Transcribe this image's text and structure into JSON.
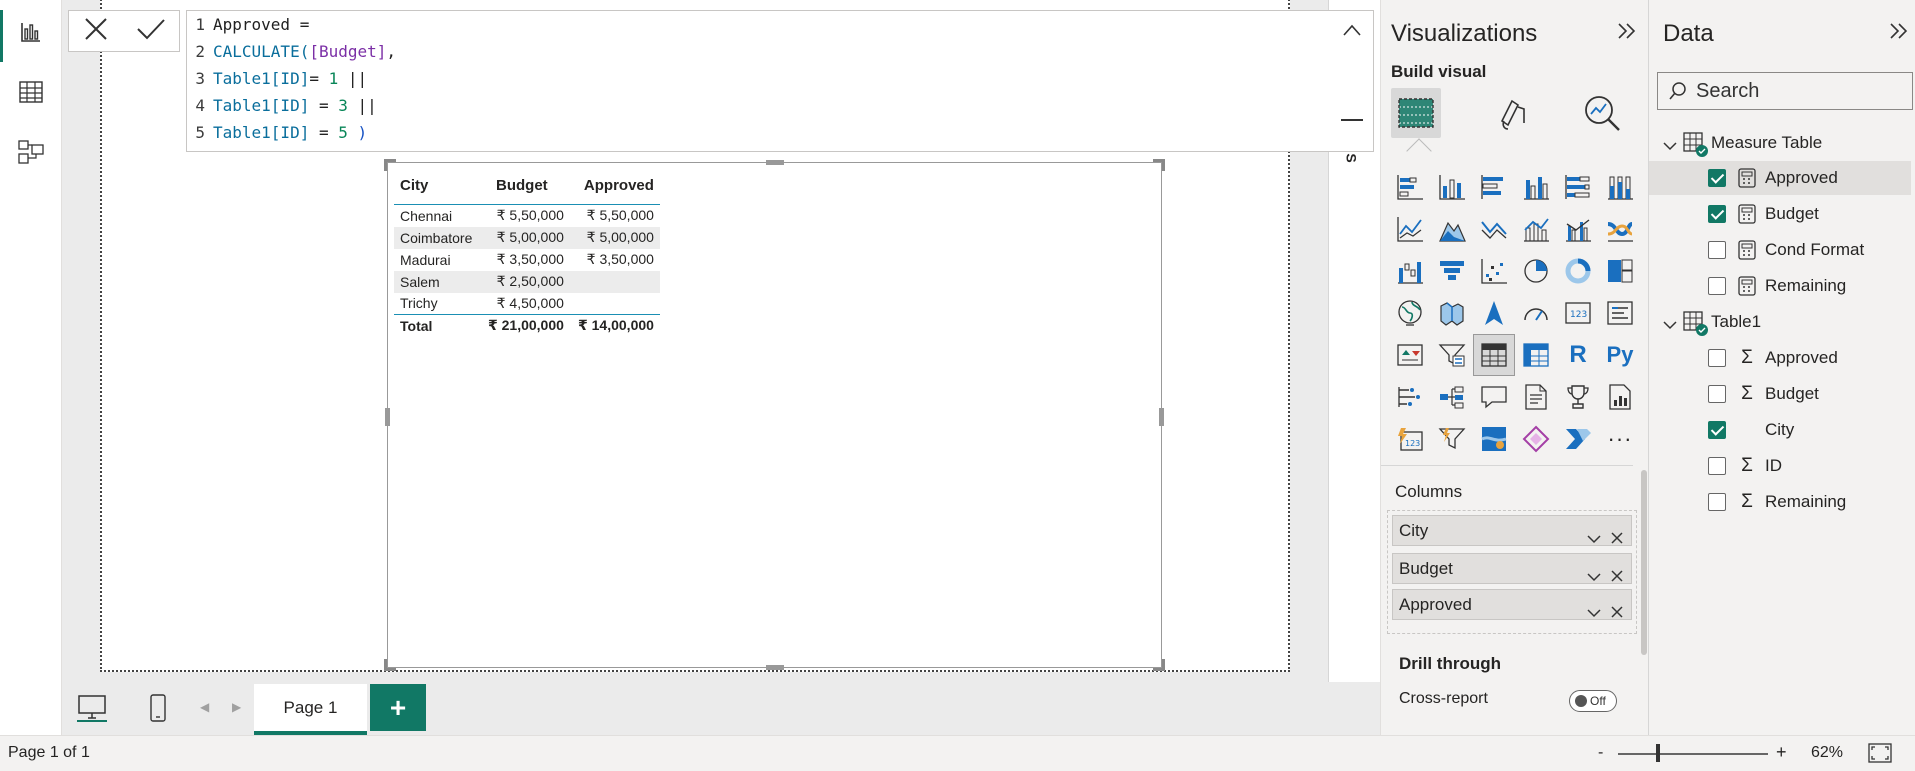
{
  "formula": {
    "line_numbers": [
      "1",
      "2",
      "3",
      "4",
      "5"
    ],
    "line1": "Approved =",
    "line2_fn": "CALCULATE(",
    "line2_ref": "[Budget]",
    "line2_end": ",",
    "line3_table": "Table1[ID]",
    "line3_op": "= ",
    "line3_num": "1",
    "line3_end": " ||",
    "line4_table": "Table1[ID]",
    "line4_op": " = ",
    "line4_num": "3",
    "line4_end": " ||",
    "line5_table": "Table1[ID]",
    "line5_op": " = ",
    "line5_num": "5",
    "line5_end": " )"
  },
  "table_visual": {
    "headers": [
      "City",
      "Budget",
      "Approved"
    ],
    "rows": [
      [
        "Chennai",
        "₹ 5,50,000",
        "₹ 5,50,000"
      ],
      [
        "Coimbatore",
        "₹ 5,00,000",
        "₹ 5,00,000"
      ],
      [
        "Madurai",
        "₹ 3,50,000",
        "₹ 3,50,000"
      ],
      [
        "Salem",
        "₹ 2,50,000",
        ""
      ],
      [
        "Trichy",
        "₹ 4,50,000",
        ""
      ]
    ],
    "total": [
      "Total",
      "₹ 21,00,000",
      "₹ 14,00,000"
    ]
  },
  "canvas": {
    "side_letter": "S"
  },
  "page_tabs": {
    "page1_label": "Page 1",
    "add_label": "+"
  },
  "status": {
    "page_info": "Page 1 of 1",
    "zoom_minus": "-",
    "zoom_plus": "+",
    "zoom_value": "62%"
  },
  "visualizations": {
    "title": "Visualizations",
    "build_label": "Build visual",
    "more_glyph": "···",
    "r_glyph": "R",
    "py_glyph": "Py",
    "columns_label": "Columns",
    "column_fields": [
      "City",
      "Budget",
      "Approved"
    ],
    "drill_title": "Drill through",
    "cross_report_label": "Cross-report",
    "cross_report_toggle": "Off"
  },
  "data_pane": {
    "title": "Data",
    "search_placeholder": "Search",
    "measure_table_label": "Measure Table",
    "measure_fields": [
      "Approved",
      "Budget",
      "Cond Format",
      "Remaining"
    ],
    "table1_label": "Table1",
    "table1_fields": [
      "Approved",
      "Budget",
      "City",
      "ID",
      "Remaining"
    ],
    "sigma": "Σ"
  },
  "colors": {
    "accent": "#117865",
    "table_rule": "#1a8fb4",
    "viz_blue": "#1a6fbf"
  }
}
